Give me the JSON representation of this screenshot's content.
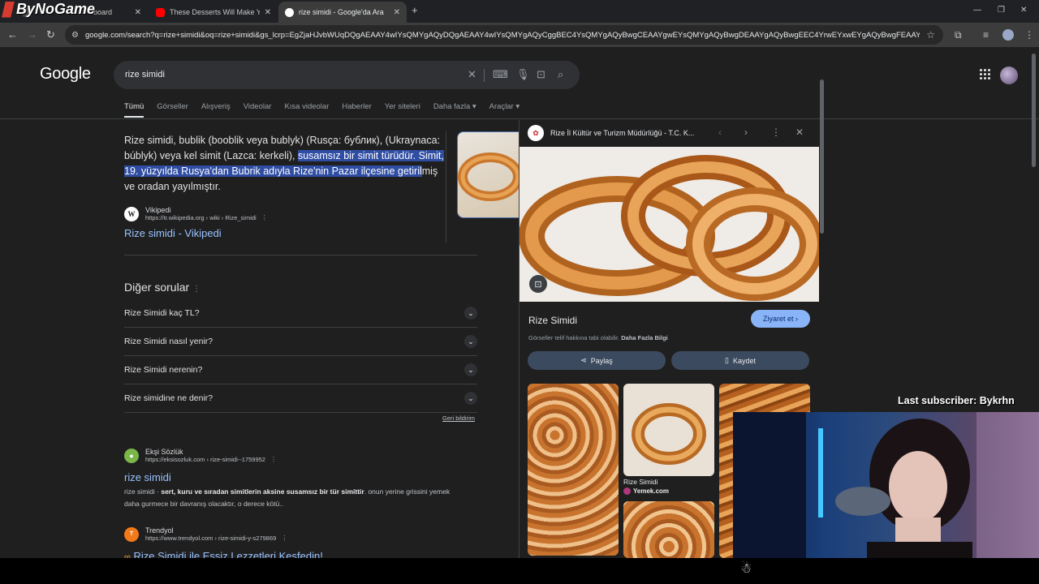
{
  "overlay": {
    "logo_text": "ByNoGame",
    "last_subscriber": "Last subscriber: Bykrhn"
  },
  "browser": {
    "tabs": [
      {
        "label": "board",
        "active": false
      },
      {
        "label": "These Desserts Will Make Your",
        "active": false
      },
      {
        "label": "rize simidi - Google'da Ara",
        "active": true
      }
    ],
    "url": "google.com/search?q=rize+simidi&oq=rize+simidi&gs_lcrp=EgZjaHJvbWUqDQgAEAAY4wIYsQMYgAQyDQgAEAAY4wIYsQMYgAQyCggBEC4YsQMYgAQyBwgCEAAYgwEYsQMYgAQyBwgDEAAYgAQyBwgEEC4YrwEYxwEYgAQyBwgFEAAYgAQyBwgGEA..."
  },
  "search": {
    "logo": "Google",
    "query": "rize simidi",
    "tabs": [
      "Tümü",
      "Görseller",
      "Alışveriş",
      "Videolar",
      "Kısa videolar",
      "Haberler",
      "Yer siteleri",
      "Daha fazla",
      "Araçlar"
    ]
  },
  "featured": {
    "text_plain_1": "Rize simidi, bublik (booblik veya bublyk) (Rusça: бублик), (Ukraynaca: búblyk) veya kel simit (Lazca: kerkeli), ",
    "text_hl": "susamsız bir simit türüdür. Simit, 19. yüzyılda Rusya'dan Bubrik adıyla Rize'nin Pazar ilçesine getiril",
    "text_plain_2": "miş ve oradan yayılmıştır.",
    "source_name": "Vikipedi",
    "source_url": "https://tr.wikipedia.org › wiki › Rize_simidi",
    "link": "Rize simidi - Vikipedi"
  },
  "questions": {
    "title": "Diğer sorular",
    "items": [
      "Rize Simidi kaç TL?",
      "Rize Simidi nasıl yenir?",
      "Rize Simidi nerenin?",
      "Rize simidine ne denir?"
    ],
    "feedback": "Geri bildirim"
  },
  "results": [
    {
      "source_name": "Ekşi Sözlük",
      "source_url": "https://eksisozluk.com › rize-simidi--1759952",
      "title": "rize simidi",
      "snippet_pre": "rize simidi · ",
      "snippet_bold": "sert, kuru ve sıradan simitlerin aksine susamsız bir tür simittir",
      "snippet_post": ". onun yerine grissini yemek daha gurmece bir davranış olacaktır, o derece kötü.."
    },
    {
      "source_name": "Trendyol",
      "source_url": "https://www.trendyol.com › rize-simidi-y-s279869",
      "title": "Rize Simidi ile Eşsiz Lezzetleri Keşfedin!"
    }
  ],
  "panel": {
    "site": "Rize İl Kültür ve Turizm Müdürlüğü - T.C. K...",
    "title": "Rize Simidi",
    "visit": "Ziyaret et",
    "copyright": "Görseller telif hakkına tabi olabilir.",
    "copyright_link": "Daha Fazla Bilgi",
    "share": "Paylaş",
    "save": "Kaydet",
    "thumb_caption": "Rize Simidi",
    "thumb_source": "Yemek.com"
  }
}
